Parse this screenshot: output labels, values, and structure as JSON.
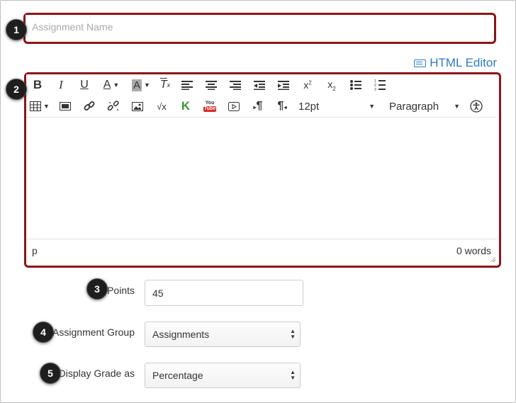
{
  "assignment_name": {
    "placeholder": "Assignment Name",
    "value": ""
  },
  "html_editor_label": "HTML Editor",
  "toolbar": {
    "row1": [
      "B",
      "I",
      "U",
      "A",
      "A",
      "Tx",
      "align-left",
      "align-center",
      "align-right",
      "outdent",
      "indent",
      "x²",
      "x₂",
      "bullet-list",
      "numbered-list"
    ],
    "font_size": "12pt",
    "block_format": "Paragraph"
  },
  "status_bar": {
    "path": "p",
    "word_count": "0 words"
  },
  "points": {
    "label": "Points",
    "value": "45"
  },
  "assignment_group": {
    "label": "Assignment Group",
    "value": "Assignments"
  },
  "display_grade": {
    "label": "Display Grade as",
    "value": "Percentage"
  },
  "callouts": [
    "1",
    "2",
    "3",
    "4",
    "5"
  ],
  "colors": {
    "highlight": "#8c1518",
    "link": "#2d7bc4",
    "callout": "#1e1e1e"
  }
}
